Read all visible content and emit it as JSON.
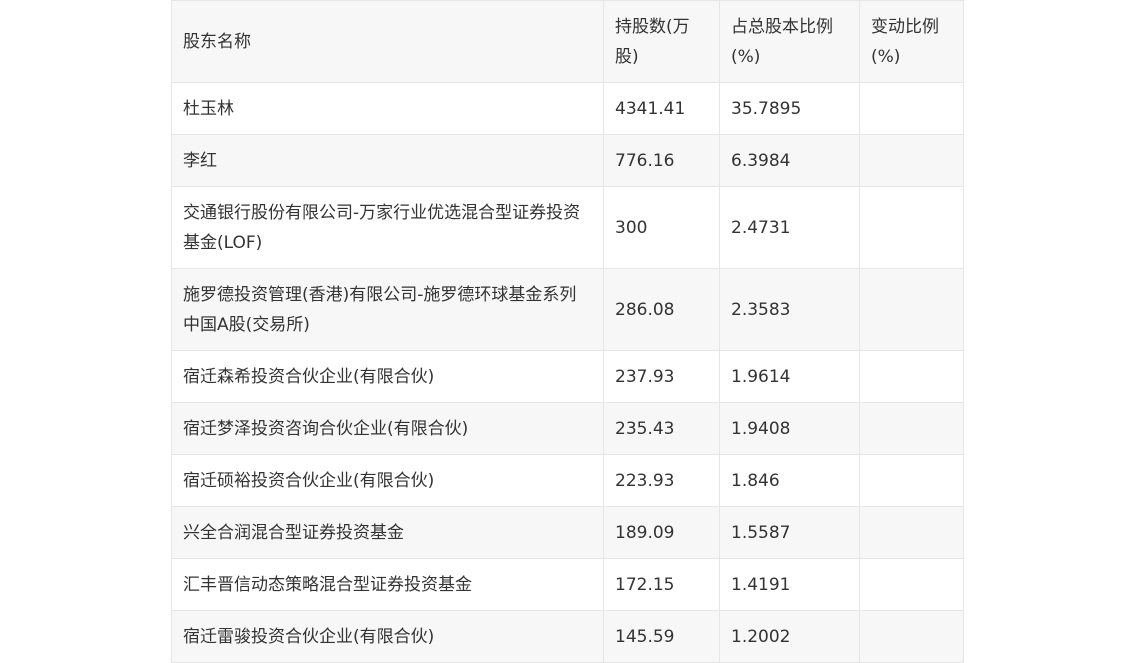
{
  "table": {
    "headers": [
      "股东名称",
      "持股数(万股)",
      "占总股本比例(%)",
      "变动比例(%)"
    ],
    "rows": [
      {
        "name": "杜玉林",
        "shares": "4341.41",
        "ratio": "35.7895",
        "change": ""
      },
      {
        "name": "李红",
        "shares": "776.16",
        "ratio": "6.3984",
        "change": ""
      },
      {
        "name": "交通银行股份有限公司-万家行业优选混合型证券投资基金(LOF)",
        "shares": "300",
        "ratio": "2.4731",
        "change": ""
      },
      {
        "name": "施罗德投资管理(香港)有限公司-施罗德环球基金系列中国A股(交易所)",
        "shares": "286.08",
        "ratio": "2.3583",
        "change": ""
      },
      {
        "name": "宿迁森希投资合伙企业(有限合伙)",
        "shares": "237.93",
        "ratio": "1.9614",
        "change": ""
      },
      {
        "name": "宿迁梦泽投资咨询合伙企业(有限合伙)",
        "shares": "235.43",
        "ratio": "1.9408",
        "change": ""
      },
      {
        "name": "宿迁硕裕投资合伙企业(有限合伙)",
        "shares": "223.93",
        "ratio": "1.846",
        "change": ""
      },
      {
        "name": "兴全合润混合型证券投资基金",
        "shares": "189.09",
        "ratio": "1.5587",
        "change": ""
      },
      {
        "name": "汇丰晋信动态策略混合型证券投资基金",
        "shares": "172.15",
        "ratio": "1.4191",
        "change": ""
      },
      {
        "name": "宿迁雷骏投资合伙企业(有限合伙)",
        "shares": "145.59",
        "ratio": "1.2002",
        "change": ""
      }
    ]
  }
}
